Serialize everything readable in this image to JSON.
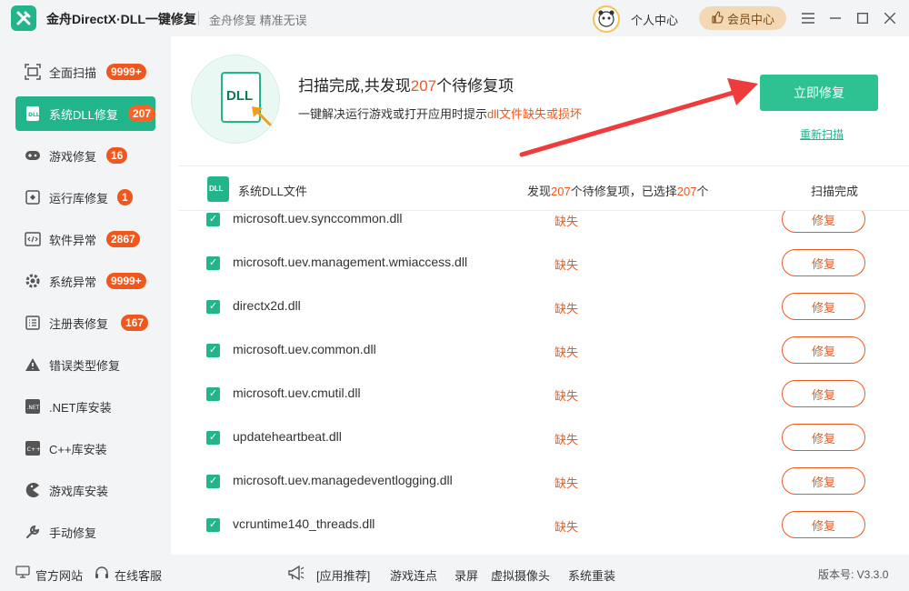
{
  "app": {
    "title": "金舟DirectX·DLL一键修复",
    "slogan": "金舟修复 精准无误",
    "user_center": "个人中心",
    "vip_label": "会员中心"
  },
  "sidebar": {
    "items": [
      {
        "label": "全面扫描",
        "badge": "9999+",
        "icon": "full-scan-icon"
      },
      {
        "label": "系统DLL修复",
        "badge": "207",
        "icon": "dll-file-icon"
      },
      {
        "label": "游戏修复",
        "badge": "16",
        "icon": "gamepad-icon"
      },
      {
        "label": "运行库修复",
        "badge": "1",
        "icon": "runtime-library-icon"
      },
      {
        "label": "软件异常",
        "badge": "2867",
        "icon": "code-window-icon"
      },
      {
        "label": "系统异常",
        "badge": "9999+",
        "icon": "gear-icon"
      },
      {
        "label": "注册表修复",
        "badge": "167",
        "icon": "list-icon"
      },
      {
        "label": "错误类型修复",
        "badge": "",
        "icon": "warning-icon"
      },
      {
        "label": ".NET库安装",
        "badge": "",
        "icon": "dotnet-icon"
      },
      {
        "label": "C++库安装",
        "badge": "",
        "icon": "cpp-icon"
      },
      {
        "label": "游戏库安装",
        "badge": "",
        "icon": "pacman-icon"
      },
      {
        "label": "手动修复",
        "badge": "",
        "icon": "wrench-icon"
      }
    ]
  },
  "hero": {
    "icon_label": "DLL",
    "title_prefix": "扫描完成,共发现",
    "title_count": "207",
    "title_suffix": "个待修复项",
    "sub_prefix": "一键解决运行游戏或打开应用时提示",
    "sub_highlight": "dll文件缺失或损坏",
    "fix_all_label": "立即修复",
    "rescan_label": "重新扫描"
  },
  "list_header": {
    "icon_label": "DLL",
    "title": "系统DLL文件",
    "count_prefix": "发现",
    "found": "207",
    "count_mid": "个待修复项，已选择",
    "selected": "207",
    "count_suffix": "个",
    "status": "扫描完成"
  },
  "rows": [
    {
      "name": "microsoft.uev.synccommon.dll",
      "status": "缺失",
      "action": "修复"
    },
    {
      "name": "microsoft.uev.management.wmiaccess.dll",
      "status": "缺失",
      "action": "修复"
    },
    {
      "name": "directx2d.dll",
      "status": "缺失",
      "action": "修复"
    },
    {
      "name": "microsoft.uev.common.dll",
      "status": "缺失",
      "action": "修复"
    },
    {
      "name": "microsoft.uev.cmutil.dll",
      "status": "缺失",
      "action": "修复"
    },
    {
      "name": "updateheartbeat.dll",
      "status": "缺失",
      "action": "修复"
    },
    {
      "name": "microsoft.uev.managedeventlogging.dll",
      "status": "缺失",
      "action": "修复"
    },
    {
      "name": "vcruntime140_threads.dll",
      "status": "缺失",
      "action": "修复"
    }
  ],
  "footer": {
    "website": "官方网站",
    "support": "在线客服",
    "recommend": "[应用推荐]",
    "links": [
      "游戏连点",
      "录屏",
      "虚拟摄像头",
      "系统重装"
    ],
    "version": "版本号: V3.3.0"
  },
  "colors": {
    "accent": "#22b58c",
    "warning": "#f0571c",
    "vip": "#f3d9b3"
  }
}
